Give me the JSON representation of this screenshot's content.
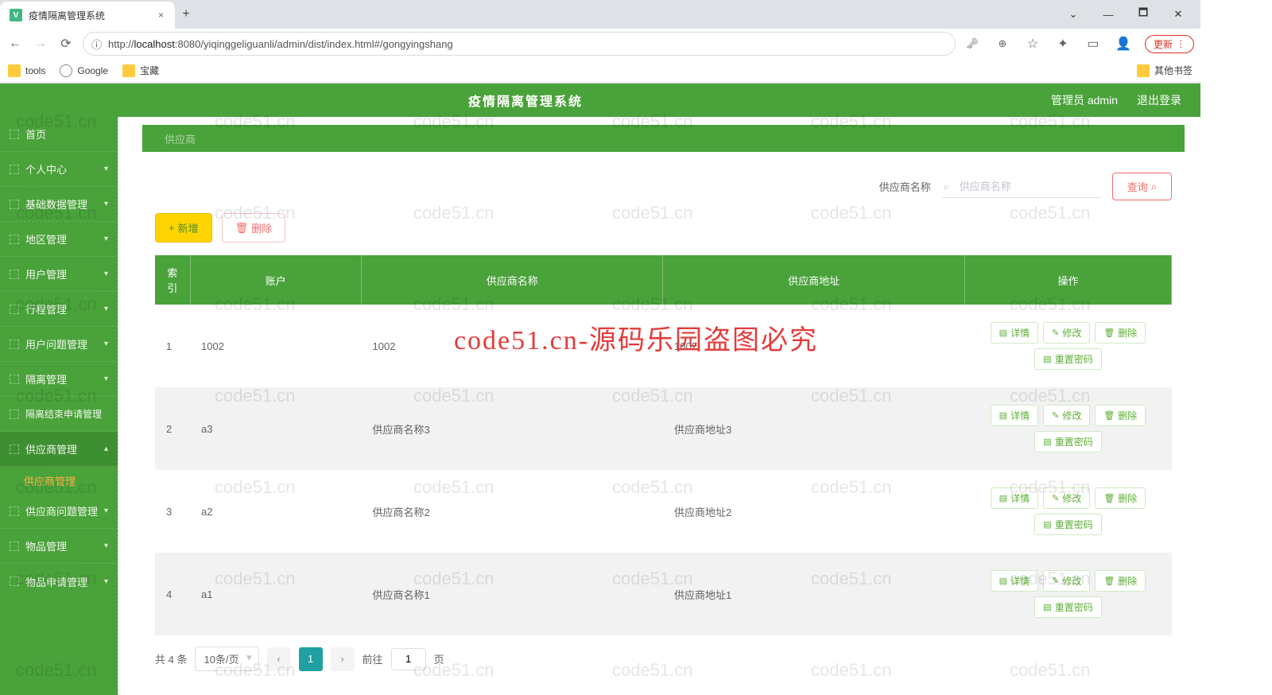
{
  "browser": {
    "tab_title": "疫情隔离管理系统",
    "url_proto_info": "ⓘ",
    "url_prefix": "http://",
    "url_host": "localhost",
    "url_rest": ":8080/yiqinggeliguanli/admin/dist/index.html#/gongyingshang",
    "update_label": "更新",
    "bookmarks": {
      "tools": "tools",
      "google": "Google",
      "treasure": "宝藏",
      "other": "其他书签"
    }
  },
  "header": {
    "title": "疫情隔离管理系统",
    "user_label": "管理员 admin",
    "logout": "退出登录"
  },
  "sidebar": {
    "items": [
      {
        "label": "首页"
      },
      {
        "label": "个人中心"
      },
      {
        "label": "基础数据管理"
      },
      {
        "label": "地区管理"
      },
      {
        "label": "用户管理"
      },
      {
        "label": "行程管理"
      },
      {
        "label": "用户问题管理"
      },
      {
        "label": "隔离管理"
      },
      {
        "label": "隔离结束申请管理"
      },
      {
        "label": "供应商管理"
      },
      {
        "label": "供应商问题管理"
      },
      {
        "label": "物品管理"
      },
      {
        "label": "物品申请管理"
      }
    ],
    "active_sub": "供应商管理"
  },
  "breadcrumb": "供应商",
  "filter": {
    "label": "供应商名称",
    "placeholder": "供应商名称",
    "query": "查询"
  },
  "actions": {
    "add": "新增",
    "delete": "删除"
  },
  "table": {
    "headers": [
      "索引",
      "账户",
      "供应商名称",
      "供应商地址",
      "操作"
    ],
    "rows": [
      {
        "idx": "1",
        "account": "1002",
        "name": "1002",
        "addr": "1002"
      },
      {
        "idx": "2",
        "account": "a3",
        "name": "供应商名称3",
        "addr": "供应商地址3"
      },
      {
        "idx": "3",
        "account": "a2",
        "name": "供应商名称2",
        "addr": "供应商地址2"
      },
      {
        "idx": "4",
        "account": "a1",
        "name": "供应商名称1",
        "addr": "供应商地址1"
      }
    ],
    "ops": {
      "detail": "详情",
      "edit": "修改",
      "del": "删除",
      "reset": "重置密码"
    }
  },
  "pager": {
    "total": "共 4 条",
    "per_page": "10条/页",
    "current": "1",
    "goto_prefix": "前往",
    "goto_value": "1",
    "goto_suffix": "页"
  },
  "watermark_text": "code51.cn",
  "watermark_center": "code51.cn-源码乐园盗图必究"
}
